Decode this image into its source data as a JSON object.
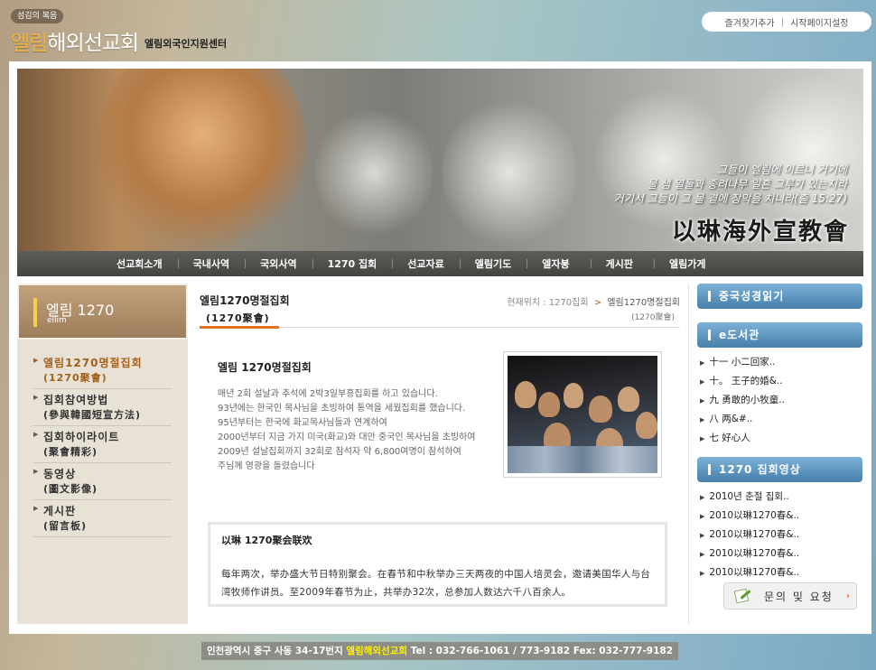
{
  "header": {
    "tag": "섬김의 복음",
    "logo_hl": "엘림",
    "logo_rest": "해외선교회",
    "subtitle": "엘림외국인지원센터",
    "top_links": [
      "즐겨찾기추가",
      "시작페이지설정"
    ],
    "top_sep": "|"
  },
  "banner": {
    "quote": [
      "그들이 엘림에 이르니 거기에",
      "물 샘 열둘과 종려나무 일흔 그루가 있는지라",
      "거기서 그들이 그 물 곁에 장막을 치니라(출 15:27)"
    ],
    "hanja": "以琳海外宣教會"
  },
  "nav": [
    "선교회소개",
    "국내사역",
    "국외사역",
    "1270 집회",
    "선교자료",
    "엘림기도",
    "엘자봉",
    "게시판",
    "엘림가게"
  ],
  "left": {
    "title": "엘림 1270",
    "title_en": "ellim",
    "arrow": "▶",
    "menu": [
      {
        "ko": "엘림1270명절집회",
        "zh": "(1270聚會)",
        "active": true
      },
      {
        "ko": "집회참여방법",
        "zh": "(參與韓國短宣方法)"
      },
      {
        "ko": "집회하이라이트",
        "zh": "(聚會精彩)"
      },
      {
        "ko": "동영상",
        "zh": "(圖文影像)"
      },
      {
        "ko": "게시판",
        "zh": "(留言板)"
      }
    ]
  },
  "content": {
    "title_ko": "엘림1270명절집회",
    "title_zh": "(1270聚會)",
    "crumb_prefix": "현재위치 : 1270집회",
    "crumb_sep": ">",
    "crumb_current": "엘림1270명절집회",
    "crumb_sub": "(1270聚會)",
    "intro_title": "엘림 1270명절집회",
    "intro_lines": [
      "매년 2회 설날과 추석에 2박3일부흥집회를 하고 있습니다.",
      "93년에는 한국인 목사님을 초빙하여 통역을 세웠집회를 했습니다.",
      "95년부터는 한국에 화교목사님들과 연계하여",
      "2000년부터 지금 가지 미국(화교)와 대만 중국인 목사님을 초빙하여",
      "2009년 설날집회까지 32회로 참석자 약 6,800여명이 참석하여",
      "주님께 영광을 돌렸습니다"
    ],
    "zh_title": "以琳 1270聚会联欢",
    "zh_body": "每年两次，举办盛大节日特别聚会。在春节和中秋举办三天两夜的中国人培灵会，邀请美国华人与台湾牧师作讲员。至2009年春节为止，共举办32次，总参加人数达六千八百余人。"
  },
  "right": {
    "box1": "중국성경읽기",
    "box2": "e도서관",
    "library": [
      "十一 小二回家..",
      "十。 王子的婚&..",
      "九 勇敢的小牧童..",
      "八 两&#..",
      "七 好心人"
    ],
    "box3": "1270 집회영상",
    "videos": [
      "2010년 춘절 집회..",
      "2010以琳1270春&..",
      "2010以琳1270春&..",
      "2010以琳1270春&..",
      "2010以琳1270春&.."
    ],
    "arrow": "▶",
    "request_label": "문의 및 요청",
    "request_go": "›"
  },
  "footer": {
    "address": "인천광역시 중구 사동 34-17번지",
    "name": "엘림해외선교회",
    "contact": "Tel : 032-766-1061 / 773-9182 Fex: 032-777-9182"
  },
  "colors": {
    "accent_orange": "#e07022",
    "accent_blue": "#477fab",
    "logo_gold": "#f4b336"
  }
}
